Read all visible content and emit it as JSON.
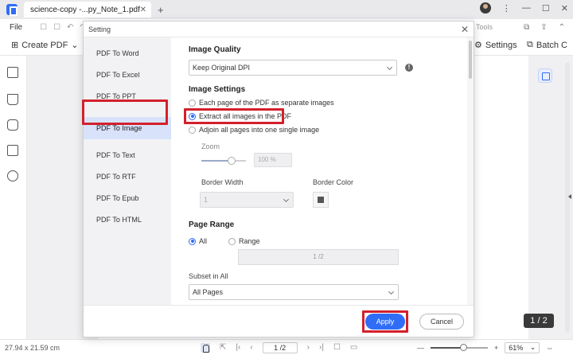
{
  "window": {
    "tab_title": "science-copy -...py_Note_1.pdf",
    "tab_close": "✕",
    "new_tab": "+",
    "controls": {
      "menu": "⋮",
      "minimize": "—",
      "maximize": "☐",
      "close": "✕"
    }
  },
  "menubar": {
    "file": "File",
    "tools": "Tools"
  },
  "toolbar": {
    "create_pdf": "Create PDF",
    "settings": "Settings",
    "batch": "Batch C"
  },
  "dialog": {
    "title": "Setting",
    "close": "✕",
    "nav": [
      {
        "label": "PDF To Word"
      },
      {
        "label": "PDF To Excel"
      },
      {
        "label": "PDF To PPT"
      },
      {
        "label": "PDF To Image"
      },
      {
        "label": "PDF To Text"
      },
      {
        "label": "PDF To RTF"
      },
      {
        "label": "PDF To Epub"
      },
      {
        "label": "PDF To HTML"
      }
    ],
    "active_nav": "PDF To Image",
    "image_quality": {
      "heading": "Image Quality",
      "value": "Keep Original DPI",
      "info": "!"
    },
    "image_settings": {
      "heading": "Image Settings",
      "options": [
        {
          "label": "Each page of the PDF as separate images",
          "selected": false
        },
        {
          "label": "Extract all images in the PDF",
          "selected": true
        },
        {
          "label": "Adjoin all pages into one single image",
          "selected": false
        }
      ],
      "zoom_label": "Zoom",
      "zoom_value": "100 %",
      "border_width_label": "Border Width",
      "border_width_value": "1",
      "border_color_label": "Border Color"
    },
    "page_range": {
      "heading": "Page Range",
      "all_label": "All",
      "range_label": "Range",
      "range_value": "1 /2",
      "subset_label": "Subset in All",
      "subset_value": "All Pages"
    },
    "apply": "Apply",
    "cancel": "Cancel"
  },
  "statusbar": {
    "dimensions": "27.94 x 21.59 cm",
    "page_value": "1 /2",
    "zoom_value": "61%",
    "zoom_minus": "—",
    "zoom_plus": "+"
  },
  "page_badge": "1 / 2",
  "colors": {
    "accent": "#2f6df6",
    "highlight": "#d3202c"
  }
}
